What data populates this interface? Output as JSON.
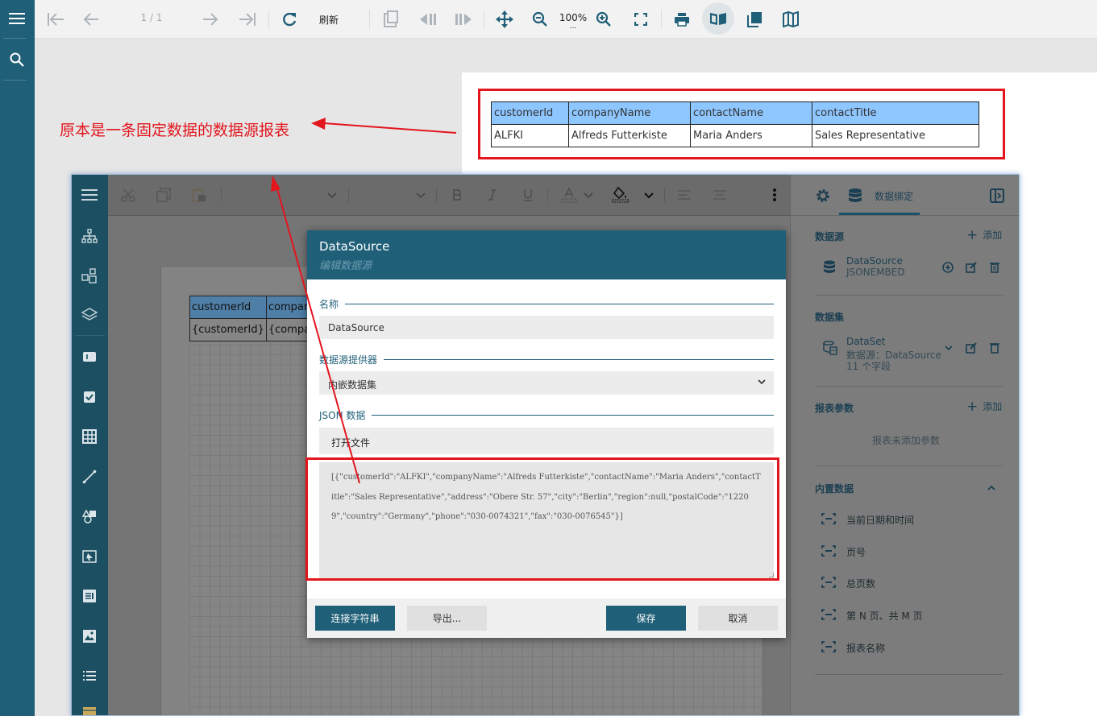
{
  "viewer": {
    "page_indicator": "1 / 1",
    "refresh_label": "刷新",
    "zoom": "100%",
    "zoom_sub": "...",
    "report_table": {
      "headers": [
        "customerId",
        "companyName",
        "contactName",
        "contactTitle"
      ],
      "row": [
        "ALFKI",
        "Alfreds Futterkiste",
        "Maria Anders",
        "Sales Representative"
      ]
    }
  },
  "annotation": {
    "note": "原本是一条固定数据的数据源报表",
    "color": "#e3151d"
  },
  "designer": {
    "canvas_table": {
      "headers": [
        "customerId",
        "company"
      ],
      "row": [
        "{customerId}",
        "{compan"
      ]
    },
    "right_panel": {
      "tab_label": "数据绑定",
      "datasource_title": "数据源",
      "add_label": "添加",
      "datasource_name": "DataSource",
      "datasource_type": "JSONEMBED",
      "dataset_title": "数据集",
      "dataset_name": "DataSet",
      "dataset_source": "数据源：DataSource",
      "dataset_fields": "11 个字段",
      "params_title": "报表参数",
      "params_empty": "报表未添加参数",
      "builtin_title": "内置数据",
      "builtin_items": [
        "当前日期和时间",
        "页号",
        "总页数",
        "第 N 页、共 M 页",
        "报表名称"
      ]
    }
  },
  "dialog": {
    "title": "DataSource",
    "subtitle": "编辑数据源",
    "name_label": "名称",
    "name_value": "DataSource",
    "provider_label": "数据源提供器",
    "provider_value": "内嵌数据集",
    "json_label": "JSON 数据",
    "open_file": "打开文件",
    "json_text": "[{\"customerId\":\"ALFKI\",\"companyName\":\"Alfreds Futterkiste\",\"contactName\":\"Maria Anders\",\"contactTitle\":\"Sales Representative\",\"address\":\"Obere Str. 57\",\"city\":\"Berlin\",\"region\":null,\"postalCode\":\"12209\",\"country\":\"Germany\",\"phone\":\"030-0074321\",\"fax\":\"030-0076545\"}]",
    "btn_connection": "连接字符串",
    "btn_export": "导出...",
    "btn_save": "保存",
    "btn_cancel": "取消",
    "accent": "#1f5f78"
  }
}
